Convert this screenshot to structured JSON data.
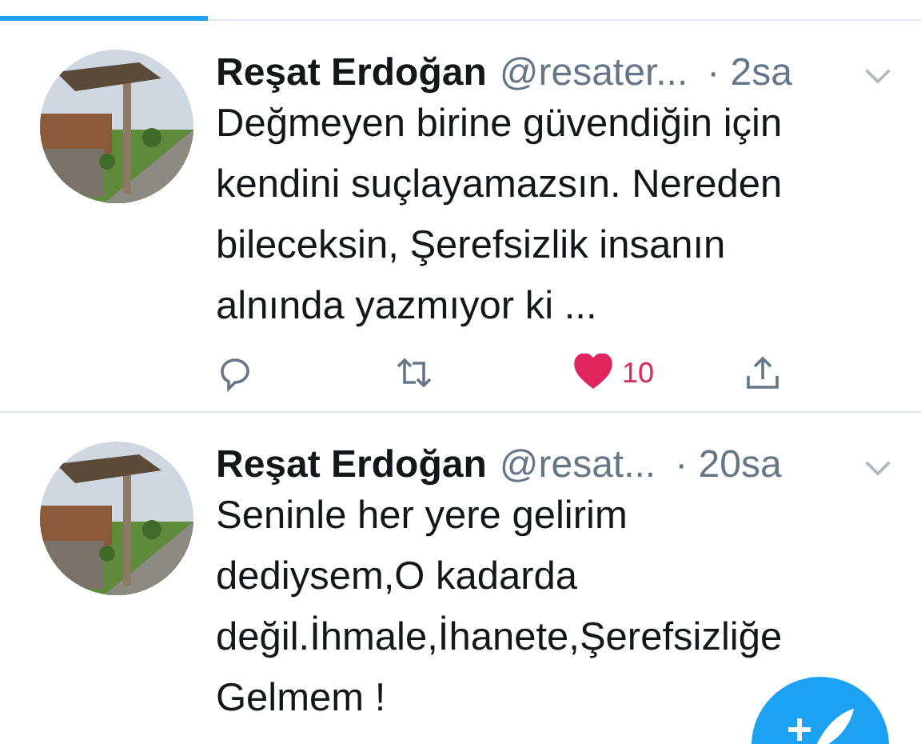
{
  "tabs": [
    {
      "selected": true
    },
    {
      "selected": false
    }
  ],
  "tweets": [
    {
      "name": "Reşat Erdoğan",
      "handle": "@resater...",
      "time": "· 2sa",
      "text": "Değmeyen birine güvendiğin için\nkendini suçlayamazsın. Nereden\nbileceksin, Şerefsizlik insanın\nalnında yazmıyor ki ...",
      "liked": true,
      "likes": "10"
    },
    {
      "name": "Reşat Erdoğan",
      "handle": "@resat...",
      "time": "· 20sa",
      "text": "Seninle her yere gelirim\ndediysem,O kadarda\ndeğil.İhmale,İhanete,Şerefsizliğe\nGelmem !"
    }
  ]
}
